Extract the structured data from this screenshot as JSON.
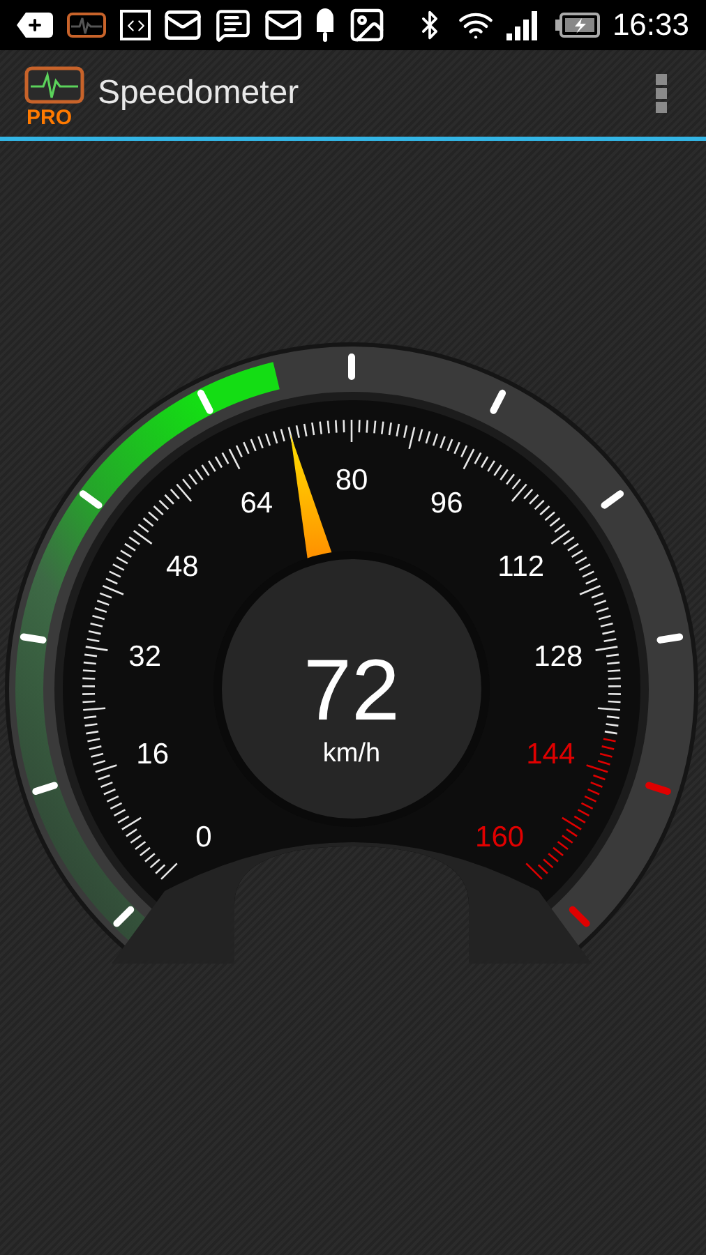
{
  "status_bar": {
    "time": "16:33"
  },
  "app_bar": {
    "logo_badge": "PRO",
    "title": "Speedometer"
  },
  "gauge": {
    "speed": "72",
    "unit": "km/h",
    "level": 0.45,
    "scale_labels": [
      {
        "text": "0",
        "color": "#ffffff"
      },
      {
        "text": "16",
        "color": "#ffffff"
      },
      {
        "text": "32",
        "color": "#ffffff"
      },
      {
        "text": "48",
        "color": "#ffffff"
      },
      {
        "text": "64",
        "color": "#ffffff"
      },
      {
        "text": "80",
        "color": "#ffffff"
      },
      {
        "text": "96",
        "color": "#ffffff"
      },
      {
        "text": "112",
        "color": "#ffffff"
      },
      {
        "text": "128",
        "color": "#ffffff"
      },
      {
        "text": "144",
        "color": "#e00000"
      },
      {
        "text": "160",
        "color": "#e00000"
      }
    ]
  }
}
